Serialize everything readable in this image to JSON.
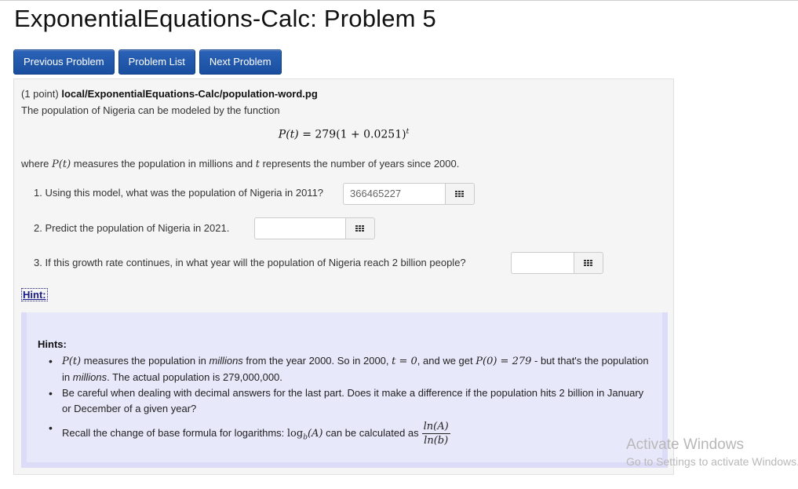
{
  "page": {
    "title": "ExponentialEquations-Calc: Problem 5"
  },
  "nav": {
    "previous": "Previous Problem",
    "list": "Problem List",
    "next": "Next Problem"
  },
  "problem": {
    "points": "(1 point)",
    "path": "local/ExponentialEquations-Calc/population-word.pg",
    "intro": "The population of Nigeria can be modeled by the function",
    "formula_lhs": "P(t)",
    "formula_rhs": " = 279(1 + 0.0251)",
    "formula_exp": "t",
    "where_1": "where ",
    "where_pt": "P(t)",
    "where_2": " measures the population in millions and ",
    "where_t": "t",
    "where_3": " represents the number of years since 2000.",
    "questions": [
      {
        "text": "1. Using this model, what was the population of Nigeria in 2011?",
        "value": "366465227"
      },
      {
        "text": "2. Predict the population of Nigeria in 2021.",
        "value": ""
      },
      {
        "text": "3. If this growth rate continues, in what year will the population of Nigeria reach 2 billion people?",
        "value": ""
      }
    ],
    "hint_link": "Hint:"
  },
  "hints": {
    "title": "Hints:",
    "h1_pt": "P(t)",
    "h1_a": " measures the population in ",
    "h1_millions": "millions",
    "h1_b": " from the year 2000. So in 2000, ",
    "h1_t0": "t = 0",
    "h1_c": ", and we get ",
    "h1_p0": "P(0) = 279",
    "h1_d": " - but that's the population in ",
    "h1_millions2": "millions",
    "h1_e": ". The actual population is 279,000,000.",
    "h2": "Be careful when dealing with decimal answers for the last part. Does it make a difference if the population hits 2 billion in January or December of a given year?",
    "h3_a": "Recall the change of base formula for logarithms: ",
    "h3_log": "log",
    "h3_sub": "b",
    "h3_arg": "(A)",
    "h3_b": " can be calculated as",
    "h3_num": "ln(A)",
    "h3_den": "ln(b)"
  },
  "watermark": {
    "line1": "Activate Windows",
    "line2": "Go to Settings to activate Windows."
  },
  "icons": {
    "answer_helper": "grid-icon"
  }
}
